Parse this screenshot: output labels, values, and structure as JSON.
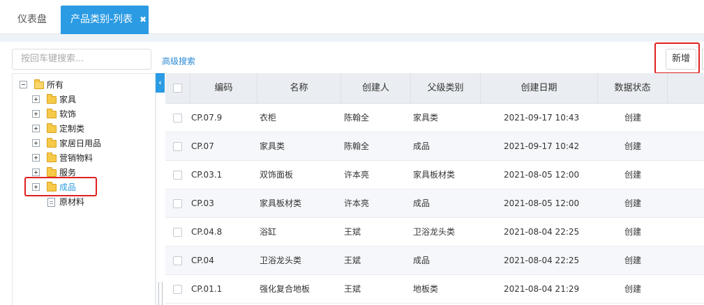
{
  "tabs": [
    {
      "label": "仪表盘"
    },
    {
      "label": "产品类别-列表"
    }
  ],
  "search": {
    "placeholder": "按回车键搜索..."
  },
  "advanced_search": "高级搜索",
  "add_button": "新增",
  "tree": {
    "root": "所有",
    "children": [
      "家具",
      "软饰",
      "定制类",
      "家居日用品",
      "营销物料",
      "服务",
      "成品",
      "原材料"
    ],
    "selected": "成品"
  },
  "table": {
    "columns": [
      "编码",
      "名称",
      "创建人",
      "父级类别",
      "创建日期",
      "数据状态"
    ],
    "rows": [
      {
        "code": "CP.07.9",
        "name": "衣柜",
        "creator": "陈翰全",
        "parent": "家具类",
        "date": "2021-09-17 10:43",
        "status": "创建"
      },
      {
        "code": "CP.07",
        "name": "家具类",
        "creator": "陈翰全",
        "parent": "成品",
        "date": "2021-09-17 10:42",
        "status": "创建"
      },
      {
        "code": "CP.03.1",
        "name": "双饰面板",
        "creator": "许本亮",
        "parent": "家具板材类",
        "date": "2021-08-05 12:00",
        "status": "创建"
      },
      {
        "code": "CP.03",
        "name": "家具板材类",
        "creator": "许本亮",
        "parent": "成品",
        "date": "2021-08-05 12:00",
        "status": "创建"
      },
      {
        "code": "CP.04.8",
        "name": "浴缸",
        "creator": "王斌",
        "parent": "卫浴龙头类",
        "date": "2021-08-04 22:25",
        "status": "创建"
      },
      {
        "code": "CP.04",
        "name": "卫浴龙头类",
        "creator": "王斌",
        "parent": "成品",
        "date": "2021-08-04 22:25",
        "status": "创建"
      },
      {
        "code": "CP.01.1",
        "name": "强化复合地板",
        "creator": "王斌",
        "parent": "地板类",
        "date": "2021-08-04 21:29",
        "status": "创建"
      }
    ]
  },
  "colors": {
    "accent": "#2b9be3",
    "highlight": "#e02020",
    "link": "#2b8ad6"
  }
}
